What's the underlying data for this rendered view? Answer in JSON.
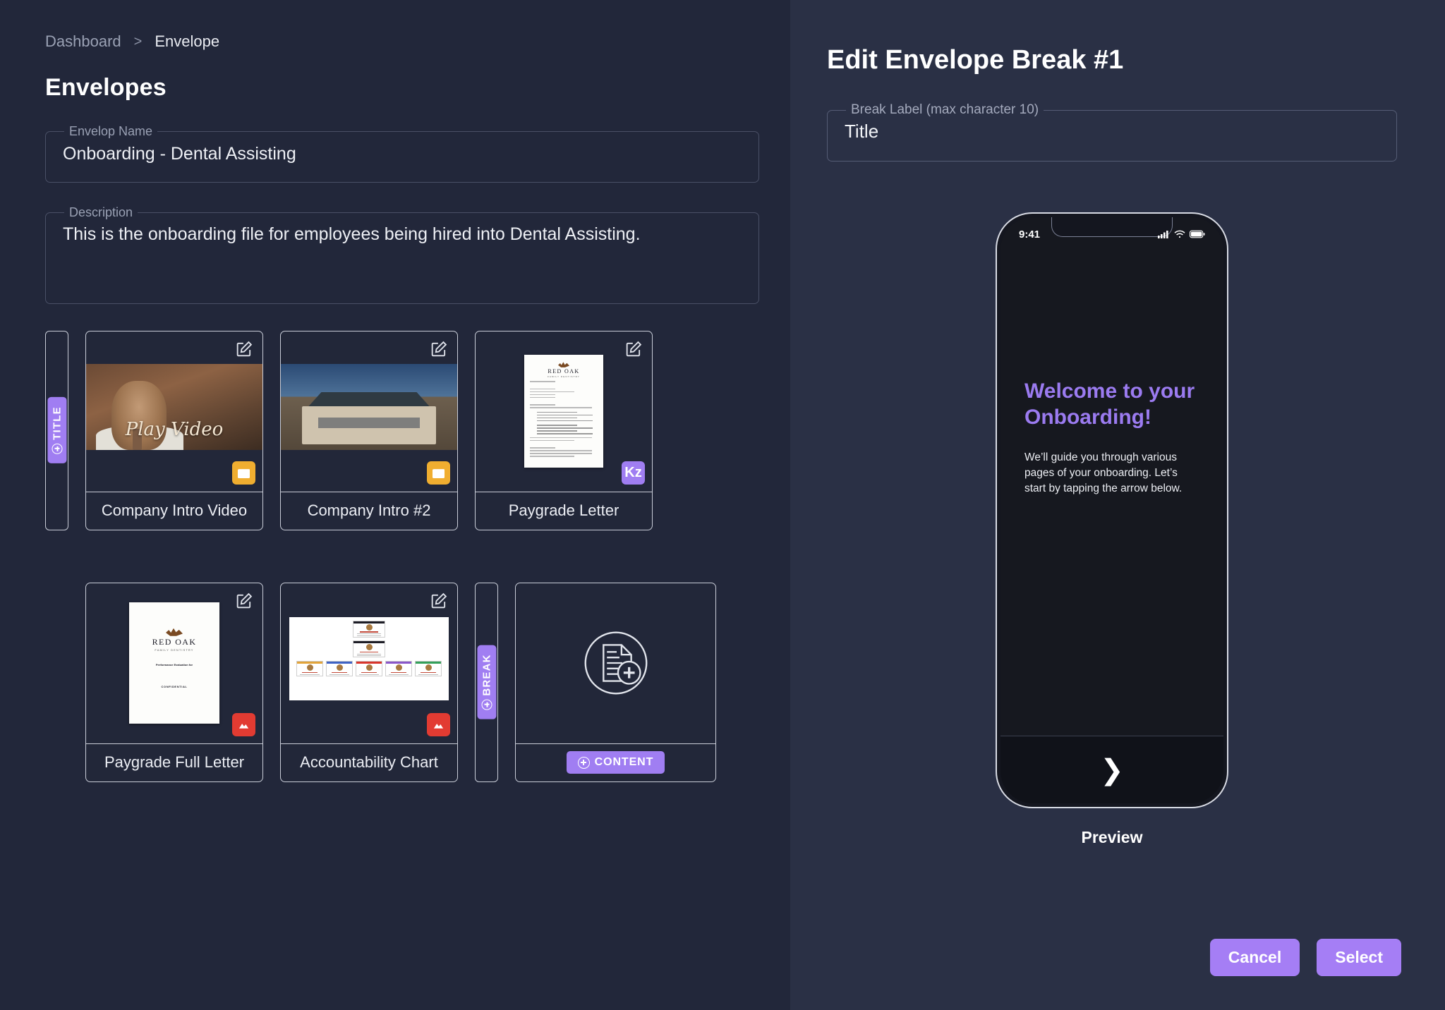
{
  "left": {
    "breadcrumb": {
      "root": "Dashboard",
      "separator": ">",
      "current": "Envelope"
    },
    "page_title": "Envelopes",
    "envelope_name": {
      "label": "Envelop Name",
      "value": "Onboarding - Dental Assisting"
    },
    "description": {
      "label": "Description",
      "value": "This is the onboarding file for employees being hired into Dental Assisting."
    },
    "rails": [
      {
        "label": "TITLE",
        "icon": "plus-circle-icon"
      },
      {
        "label": "BREAK",
        "icon": "plus-circle-icon"
      }
    ],
    "cards": [
      {
        "title": "Company Intro Video",
        "badge": "video",
        "badge_text": "",
        "thumb": "video",
        "overlay_text": "Play Video",
        "edit_icon": "edit-pencil-icon"
      },
      {
        "title": "Company Intro #2",
        "badge": "video",
        "badge_text": "",
        "thumb": "building",
        "overlay_text": "",
        "edit_icon": "edit-pencil-icon"
      },
      {
        "title": "Paygrade Letter",
        "badge": "kz",
        "badge_text": "Kz",
        "thumb": "letter",
        "overlay_text": "",
        "edit_icon": "edit-pencil-icon"
      },
      {
        "title": "Paygrade Full Letter",
        "badge": "image",
        "badge_text": "",
        "thumb": "coverletter",
        "overlay_text": "",
        "edit_icon": "edit-pencil-icon"
      },
      {
        "title": "Accountability Chart",
        "badge": "image",
        "badge_text": "",
        "thumb": "orgchart",
        "overlay_text": "",
        "edit_icon": "edit-pencil-icon"
      }
    ],
    "letterhead": {
      "brand": "RED OAK",
      "brand_sub": "FAMILY DENTISTRY",
      "cover_line": "Performance Evaluation for",
      "confidential": "CONFIDENTIAL"
    },
    "add_card": {
      "content_label": "CONTENT",
      "icon": "document-add-icon"
    }
  },
  "right": {
    "title": "Edit Envelope Break #1",
    "break_label": {
      "label": "Break Label (max character 10)",
      "value": "Title"
    },
    "phone": {
      "time": "9:41",
      "status_icons": [
        "signal-bars-icon",
        "wifi-icon",
        "battery-icon"
      ],
      "heading": "Welcome to your Onboarding!",
      "body": "We’ll guide you through various pages of your onboarding.  Let’s start by tapping the arrow below.",
      "next_arrow": "❯"
    },
    "preview_label": "Preview",
    "buttons": {
      "cancel": "Cancel",
      "select": "Select"
    }
  },
  "colors": {
    "accent": "#a07ef2",
    "heading_purple": "#9b7bf0",
    "video_badge": "#f0ae30",
    "image_badge": "#e23b32"
  }
}
